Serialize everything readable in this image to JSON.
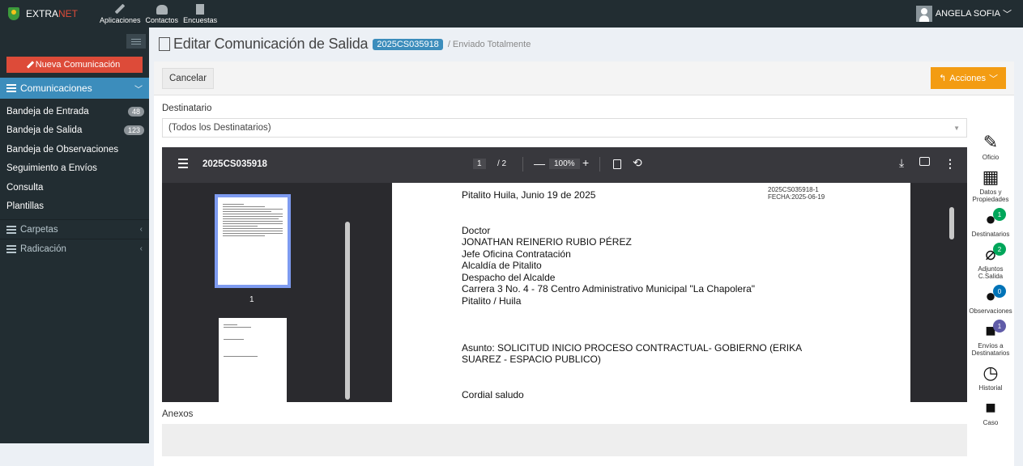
{
  "topbar": {
    "brand_pre": "EXTRA",
    "brand_post": "NET",
    "nav": [
      "Aplicaciones",
      "Contactos",
      "Encuestas"
    ],
    "user": "ANGELA SOFIA"
  },
  "sidebar": {
    "new_button": "Nueva Comunicación",
    "section": "Comunicaciones",
    "items": [
      {
        "label": "Bandeja de Entrada",
        "badge": "48"
      },
      {
        "label": "Bandeja de Salida",
        "badge": "123"
      },
      {
        "label": "Bandeja de Observaciones",
        "badge": ""
      },
      {
        "label": "Seguimiento a Envíos",
        "badge": ""
      },
      {
        "label": "Consulta",
        "badge": ""
      },
      {
        "label": "Plantillas",
        "badge": ""
      }
    ],
    "groups": [
      "Carpetas",
      "Radicación"
    ]
  },
  "main": {
    "title": "Editar Comunicación de Salida",
    "code": "2025CS035918",
    "status": "/ Enviado Totalmente",
    "cancel": "Cancelar",
    "actions": "Acciones",
    "dest_label": "Destinatario",
    "dest_value": "(Todos los Destinatarios)",
    "anexos": "Anexos"
  },
  "pdf": {
    "filename": "2025CS035918",
    "page": "1",
    "pages": "/ 2",
    "zoom": "100%",
    "thumb_num": "1",
    "ref1": "2025CS035918-1",
    "ref2": "FECHA:2025-06-19",
    "lines": [
      "Pitalito Huila, Junio 19 de 2025",
      "",
      "",
      "Doctor",
      "JONATHAN REINERIO RUBIO PÉREZ",
      "Jefe Oficina Contratación",
      "Alcaldía de Pitalito",
      "Despacho del Alcalde",
      "Carrera 3 No. 4 - 78 Centro Administrativo Municipal \"La Chapolera\"",
      "Pitalito / Huila",
      "",
      "",
      "",
      "Asunto:  SOLICITUD  INICIO  PROCESO  CONTRACTUAL-  GOBIERNO  (ERIKA",
      "SUAREZ - ESPACIO PUBLICO)",
      "",
      "",
      "Cordial saludo"
    ]
  },
  "rtools": [
    {
      "label": "Oficio",
      "count": ""
    },
    {
      "label": "Datos y Propiedades",
      "count": ""
    },
    {
      "label": "Destinatarios",
      "count": "1"
    },
    {
      "label": "Adjuntos C.Salida",
      "count": "2"
    },
    {
      "label": "Observaciones",
      "count": "0"
    },
    {
      "label": "Envíos a Destinatarios",
      "count": "1"
    },
    {
      "label": "Historial",
      "count": ""
    },
    {
      "label": "Caso",
      "count": ""
    }
  ]
}
